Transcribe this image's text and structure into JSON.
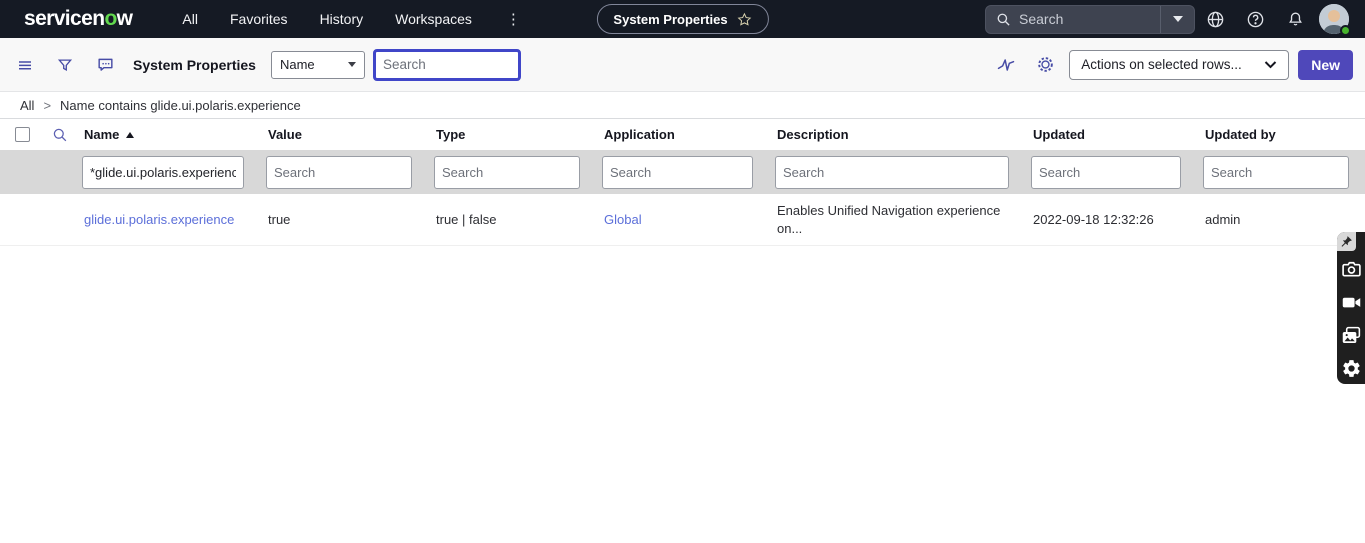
{
  "nav": {
    "logo": {
      "part1": "servicen",
      "accent": "o",
      "part2": "w"
    },
    "items": [
      "All",
      "Favorites",
      "History",
      "Workspaces"
    ],
    "pill_label": "System Properties",
    "search_placeholder": "Search"
  },
  "toolbar": {
    "title": "System Properties",
    "field_select_value": "Name",
    "search_placeholder": "Search",
    "actions_select_value": "Actions on selected rows...",
    "new_label": "New"
  },
  "breadcrumb": {
    "root": "All",
    "separator": ">",
    "query": "Name contains glide.ui.polaris.experience"
  },
  "table": {
    "columns": [
      "Name",
      "Value",
      "Type",
      "Application",
      "Description",
      "Updated",
      "Updated by"
    ],
    "sort": {
      "column": "Name",
      "direction": "ascending"
    },
    "filter_values": {
      "name": "*glide.ui.polaris.experience"
    },
    "filter_placeholder": "Search",
    "rows": [
      {
        "name": "glide.ui.polaris.experience",
        "value": "true",
        "type": "true | false",
        "application": "Global",
        "description": "Enables Unified Navigation experience on...",
        "updated": "2022-09-18 12:32:26",
        "updated_by": "admin"
      }
    ]
  },
  "colors": {
    "nav_bg": "#151a24",
    "logo_green": "#62d84e",
    "accent_indigo": "#474ca6",
    "focus_border": "#4046c8",
    "new_button": "#4f48ba",
    "link": "#5c6fd9",
    "filter_row_bg": "#d8d8d8",
    "presence_green": "#48b52e"
  },
  "icons": {
    "nav": [
      "search-icon",
      "chevron-down-icon",
      "globe-icon",
      "help-icon",
      "bell-icon",
      "more-vertical-icon",
      "star-icon"
    ],
    "toolbar": [
      "menu-icon",
      "funnel-icon",
      "chat-icon",
      "pulse-icon",
      "gear-icon"
    ],
    "list": [
      "search-icon",
      "sort-ascending-icon"
    ],
    "capture_bar": [
      "pin-icon",
      "camera-icon",
      "video-icon",
      "images-icon",
      "gear-icon"
    ]
  }
}
